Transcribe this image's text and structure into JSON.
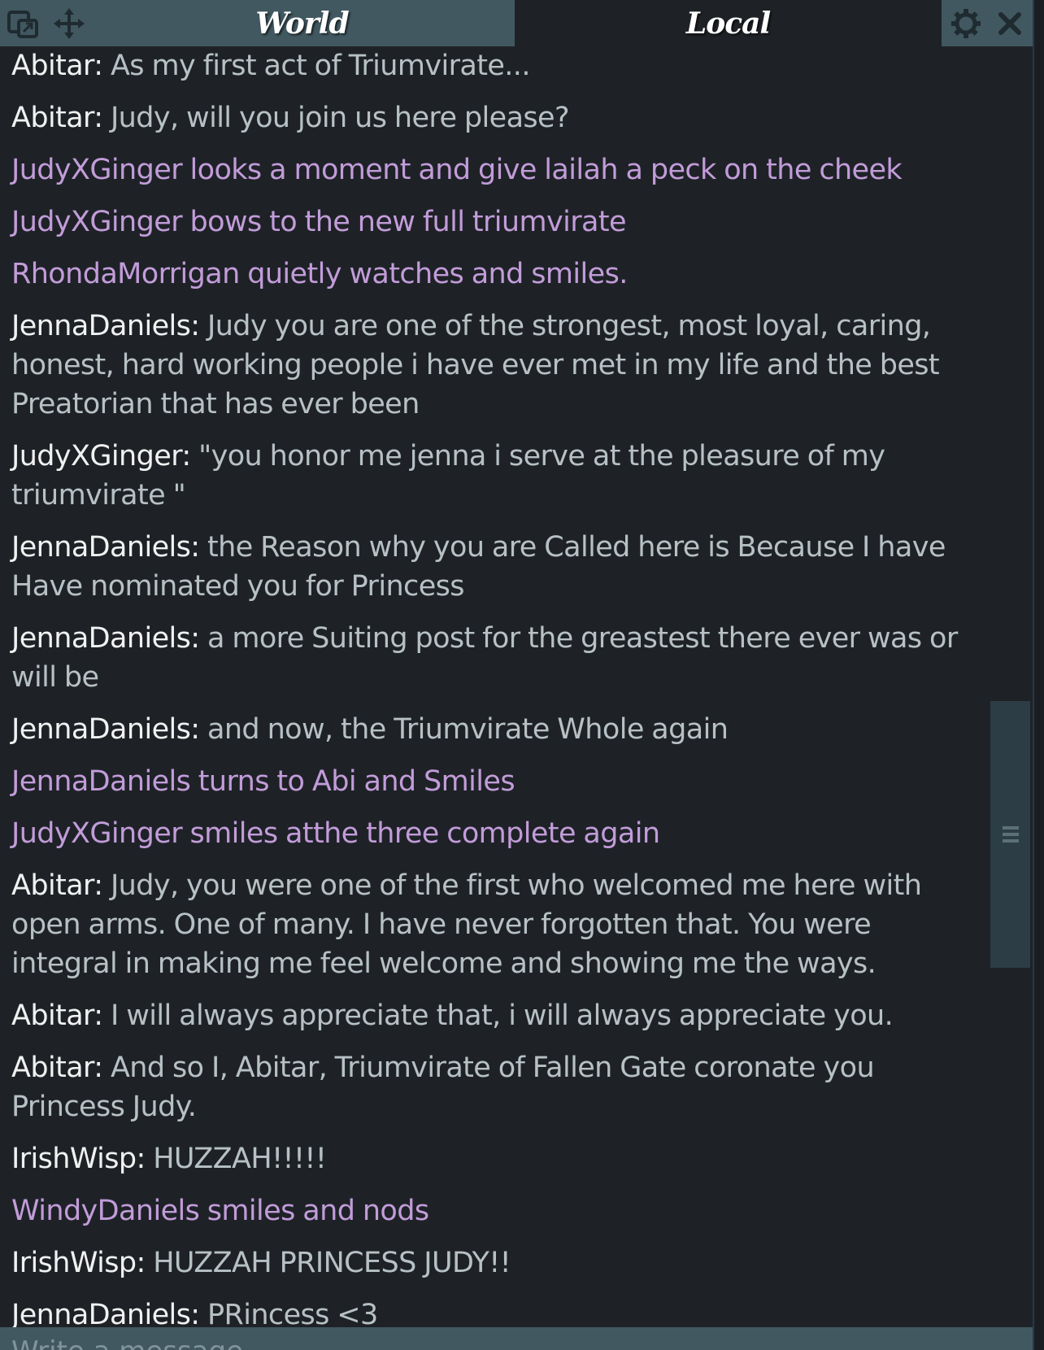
{
  "tabs": [
    {
      "label": "World",
      "active": false
    },
    {
      "label": "Local",
      "active": true
    }
  ],
  "icons": {
    "popout": "popout-window-icon",
    "move": "move-arrows-icon",
    "settings": "gear-icon",
    "close": "close-icon",
    "scroll_grip": "scrollbar-grip-icon"
  },
  "colors": {
    "background": "#1e2227",
    "tab_bar": "#415860",
    "author": "#f1f1f1",
    "message_text": "#b7c1c4",
    "emote_text": "#c29cd9",
    "scroll_thumb": "#2c3d45"
  },
  "messages": [
    {
      "type": "say",
      "author": "Abitar",
      "text": "As my first act of Triumvirate..."
    },
    {
      "type": "say",
      "author": "Abitar",
      "text": "Judy, will you join us here please?"
    },
    {
      "type": "emote",
      "text": "JudyXGinger looks a moment and give lailah a peck on the cheek"
    },
    {
      "type": "emote",
      "text": "JudyXGinger bows to the new full triumvirate"
    },
    {
      "type": "emote",
      "text": "RhondaMorrigan quietly watches and smiles."
    },
    {
      "type": "say",
      "author": "JennaDaniels",
      "text": "Judy you are one of the strongest, most loyal, caring, honest, hard working people i have ever met in my life and the best Preatorian that has ever been"
    },
    {
      "type": "say",
      "author": "JudyXGinger",
      "text": "\"you honor me jenna i serve at the pleasure of my triumvirate \""
    },
    {
      "type": "say",
      "author": "JennaDaniels",
      "text": "the Reason why you are Called here is Because I have Have nominated you for Princess"
    },
    {
      "type": "say",
      "author": "JennaDaniels",
      "text": "a more Suiting post for the greastest there ever was or will be"
    },
    {
      "type": "say",
      "author": "JennaDaniels",
      "text": "and now, the Triumvirate Whole again"
    },
    {
      "type": "emote",
      "text": "JennaDaniels turns to Abi and Smiles"
    },
    {
      "type": "emote",
      "text": "JudyXGinger smiles atthe three complete again"
    },
    {
      "type": "say",
      "author": "Abitar",
      "text": "Judy, you were one of the first who welcomed me here with open arms. One of many. I have never forgotten that. You were integral in making me feel welcome and showing me the ways."
    },
    {
      "type": "say",
      "author": "Abitar",
      "text": "I will always appreciate that, i will always appreciate you."
    },
    {
      "type": "say",
      "author": "Abitar",
      "text": "And so I, Abitar, Triumvirate of Fallen Gate coronate you Princess Judy."
    },
    {
      "type": "say",
      "author": "IrishWisp",
      "text": "HUZZAH!!!!!"
    },
    {
      "type": "emote",
      "text": "WindyDaniels smiles and nods"
    },
    {
      "type": "say",
      "author": "IrishWisp",
      "text": "HUZZAH PRINCESS JUDY!!"
    },
    {
      "type": "say",
      "author": "JennaDaniels",
      "text": "PRincess <3"
    }
  ],
  "input": {
    "placeholder": "Write a message...",
    "value": ""
  }
}
